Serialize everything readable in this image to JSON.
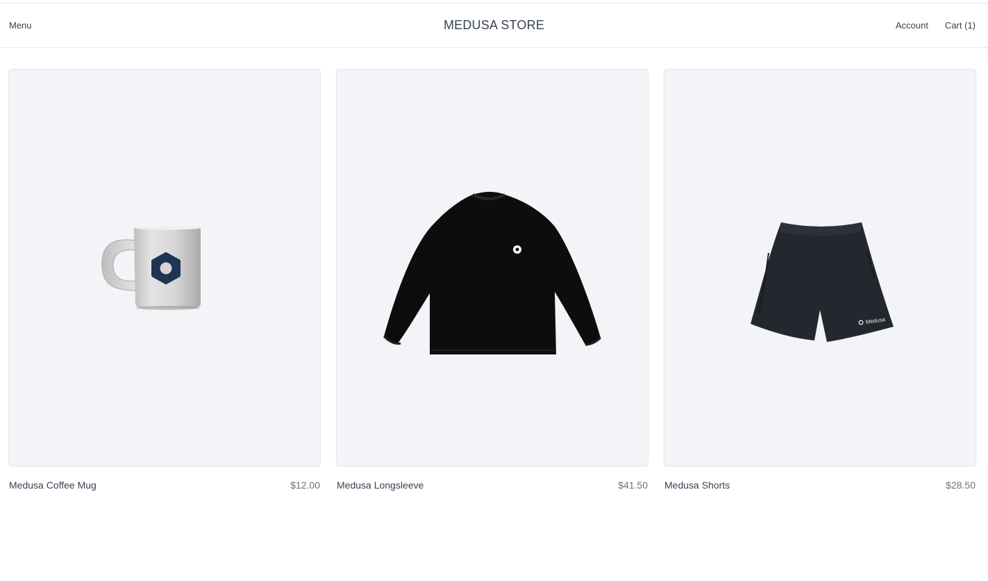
{
  "header": {
    "menu_label": "Menu",
    "store_title": "MEDUSA STORE",
    "account_label": "Account",
    "cart_label": "Cart (1)"
  },
  "products": [
    {
      "name": "Medusa Coffee Mug",
      "price": "$12.00",
      "image": "coffee-mug"
    },
    {
      "name": "Medusa Longsleeve",
      "price": "$41.50",
      "image": "longsleeve"
    },
    {
      "name": "Medusa Shorts",
      "price": "$28.50",
      "image": "shorts"
    }
  ],
  "shorts_print": "Medusa",
  "colors": {
    "thumb_bg": "#f4f4f8",
    "text": "#374151",
    "price": "#6b7280",
    "mug_logo": "#1d3453"
  }
}
